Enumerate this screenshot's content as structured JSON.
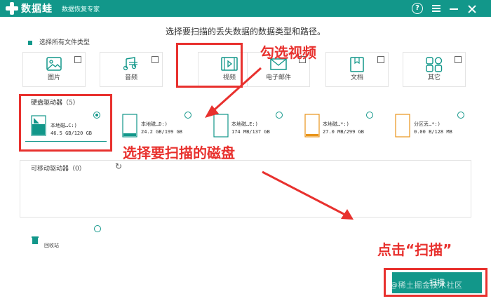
{
  "app": {
    "brand": "数据蛙",
    "slogan": "数据恢复专家",
    "help_glyph": "?",
    "accent": "#12978a"
  },
  "heading": "选择要扫描的丢失数据的数据类型和路径。",
  "select_all_label": "选择所有文件类型",
  "file_types": [
    {
      "label": "图片",
      "icon": "image-icon",
      "checked": false
    },
    {
      "label": "音频",
      "icon": "music-icon",
      "checked": false
    },
    {
      "label": "视频",
      "icon": "video-icon",
      "checked": true
    },
    {
      "label": "电子邮件",
      "icon": "mail-icon",
      "checked": false
    },
    {
      "label": "文档",
      "icon": "document-icon",
      "checked": false
    },
    {
      "label": "其它",
      "icon": "other-icon",
      "checked": false
    }
  ],
  "hard_drives": {
    "title": "硬盘驱动器（5）",
    "items": [
      {
        "name": "本地磁…C:)",
        "size": "46.5 GB/120 GB",
        "selected": true,
        "used": 0.39
      },
      {
        "name": "本地磁…D:)",
        "size": "24.2 GB/199 GB",
        "selected": false,
        "used": 0.12
      },
      {
        "name": "本地磁…E:)",
        "size": "174 MB/137 GB",
        "selected": false,
        "used": 0.01
      },
      {
        "name": "本地磁…*:)",
        "size": "27.0 MB/299 GB",
        "selected": false,
        "used": 0.01
      },
      {
        "name": "分区丢…*:)",
        "size": "0.00  B/128 MB",
        "selected": false,
        "used": 0.0
      }
    ]
  },
  "removable": {
    "title": "可移动驱动器（0）"
  },
  "recycle_bin_label": "回收站",
  "scan_button": "扫描",
  "watermark": "@稀土掘金技术社区",
  "annotations": {
    "check_video": "勾选视频",
    "choose_disk": "选择要扫描的磁盘",
    "click_scan": "点击“扫描”",
    "color": "#e8312e"
  }
}
